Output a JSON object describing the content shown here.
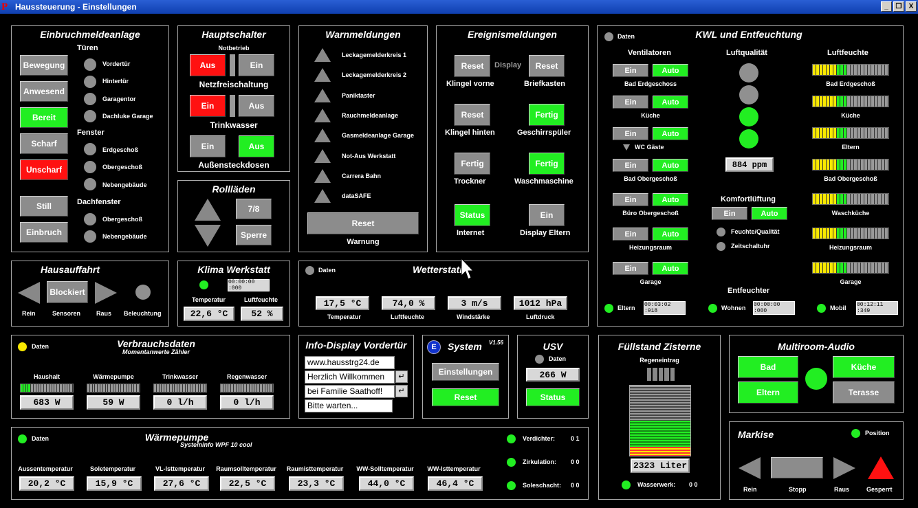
{
  "window": {
    "title": "Haussteuerung - Einstellungen",
    "logo": "P",
    "min": "_",
    "restore": "❐",
    "close": "X"
  },
  "einbruch": {
    "title": "Einbruchmeldeanlage",
    "tueren": "Türen",
    "fenster": "Fenster",
    "dachfenster": "Dachfenster",
    "btn_bewegung": "Bewegung",
    "btn_anwesend": "Anwesend",
    "btn_bereit": "Bereit",
    "btn_scharf": "Scharf",
    "btn_unscharf": "Unscharf",
    "btn_still": "Still",
    "btn_einbruch": "Einbruch",
    "t1": "Vordertür",
    "t2": "Hintertür",
    "t3": "Garagentor",
    "t4": "Dachluke Garage",
    "f1": "Erdgeschoß",
    "f2": "Obergeschoß",
    "f3": "Nebengebäude",
    "d1": "Obergeschoß",
    "d2": "Nebengebäude"
  },
  "haupt": {
    "title": "Hauptschalter",
    "notbetrieb": "Notbetrieb",
    "aus1": "Aus",
    "ein1": "Ein",
    "netzfrei": "Netzfreischaltung",
    "ein2": "Ein",
    "aus2": "Aus",
    "trinkwasser": "Trinkwasser",
    "ein3": "Ein",
    "aus3": "Aus",
    "aussen": "Außensteckdosen"
  },
  "warn": {
    "title": "Warnmeldungen",
    "items": [
      "Leckagemelderkreis 1",
      "Leckagemelderkreis 2",
      "Paniktaster",
      "Rauchmeldeanlage",
      "Gasmeldeanlage Garage",
      "Not-Aus Werkstatt",
      "Carrera Bahn",
      "dataSAFE"
    ],
    "reset": "Reset",
    "warnung": "Warnung"
  },
  "ereignis": {
    "title": "Ereignismeldungen",
    "reset1": "Reset",
    "display": "Display",
    "reset2": "Reset",
    "klingel_vorne": "Klingel vorne",
    "briefkasten": "Briefkasten",
    "reset3": "Reset",
    "fertig1": "Fertig",
    "klingel_hinten": "Klingel hinten",
    "geschirr": "Geschirrspüler",
    "fertig2": "Fertig",
    "fertig3": "Fertig",
    "trockner": "Trockner",
    "wasch": "Waschmaschine",
    "status": "Status",
    "ein": "Ein",
    "internet": "Internet",
    "display_eltern": "Display Eltern"
  },
  "kwl": {
    "title": "KWL und Entfeuchtung",
    "daten": "Daten",
    "ventilatoren": "Ventilatoren",
    "luftqualitaet": "Luftqualität",
    "luftfeuchte": "Luftfeuchte",
    "rooms": [
      "Bad Erdgeschoss",
      "Küche",
      "WC Gäste",
      "Bad Obergeschoß",
      "Büro Obergeschoß",
      "Heizungsraum",
      "Garage"
    ],
    "ein": "Ein",
    "auto": "Auto",
    "ppm": "884 ppm",
    "feuchte_rooms": [
      "Bad Erdgeschoß",
      "Küche",
      "Eltern",
      "Bad Obergeschoß",
      "Waschküche",
      "Heizungsraum",
      "Garage"
    ],
    "komfort": "Komfortlüftung",
    "k_ein": "Ein",
    "k_auto": "Auto",
    "feuchte_qual": "Feuchte/Qualität",
    "zeitschalt": "Zeitschaltuhr",
    "entfeuchter": "Entfeuchter",
    "eltern": "Eltern",
    "eltern_t": "00:03:02 :918",
    "wohnen": "Wohnen",
    "wohnen_t": "00:00:00 :000",
    "mobil": "Mobil",
    "mobil_t": "00:12:11 :349"
  },
  "rollladen": {
    "title": "Rollläden",
    "btn78": "7/8",
    "sperre": "Sperre"
  },
  "hausauffahrt": {
    "title": "Hausauffahrt",
    "blockiert": "Blockiert",
    "rein": "Rein",
    "sensoren": "Sensoren",
    "raus": "Raus",
    "beleuchtung": "Beleuchtung"
  },
  "klima": {
    "title": "Klima Werkstatt",
    "time": "00:00:00 :000",
    "temp_lbl": "Temperatur",
    "feuchte_lbl": "Luftfeuchte",
    "temp": "22,6 °C",
    "feuchte": "52 %"
  },
  "wetter": {
    "title": "Wetterstati",
    "daten": "Daten",
    "temp": "17,5 °C",
    "feuchte": "74,0 %",
    "wind": "3 m/s",
    "druck": "1012 hPa",
    "l1": "Temperatur",
    "l2": "Luftfeuchte",
    "l3": "Windstärke",
    "l4": "Luftdruck"
  },
  "verbrauch": {
    "title": "Verbrauchsdaten",
    "subtitle": "Momentanwerte Zähler",
    "daten": "Daten",
    "labels": [
      "Haushalt",
      "Wärmepumpe",
      "Trinkwasser",
      "Regenwasser"
    ],
    "values": [
      "683 W",
      "59 W",
      "0 l/h",
      "0 l/h"
    ]
  },
  "info": {
    "title": "Info-Display Vordertür",
    "lines": [
      "www.hausstrg24.de",
      "Herzlich Willkommen",
      "bei Familie Saathoff!",
      "Bitte warten..."
    ],
    "enter": "↵"
  },
  "system": {
    "title": "System",
    "version": "V1.56",
    "icon": "E",
    "einstellungen": "Einstellungen",
    "reset": "Reset"
  },
  "usv": {
    "title": "USV",
    "daten": "Daten",
    "value": "266 W",
    "status": "Status"
  },
  "zisterne": {
    "title": "Füllstand Zisterne",
    "regeneintrag": "Regeneintrag",
    "liter": "2323 Liter",
    "wasserwerk": "Wasserwerk:",
    "ww_val": "0 0",
    "fill_fraction": 0.5
  },
  "audio": {
    "title": "Multiroom-Audio",
    "bad": "Bad",
    "kueche": "Küche",
    "eltern": "Eltern",
    "terasse": "Terasse"
  },
  "markise": {
    "title": "Markise",
    "position": "Position",
    "rein": "Rein",
    "stopp": "Stopp",
    "raus": "Raus",
    "gesperrt": "Gesperrt"
  },
  "waerme": {
    "title": "Wärmepumpe",
    "subtitle": "Systeminfo WPF 10 cool",
    "daten": "Daten",
    "labels": [
      "Aussentemperatur",
      "Soletemperatur",
      "VL-Isttemperatur",
      "Raumsolltemperatur",
      "Raumisttemperatur",
      "WW-Solltemperatur",
      "WW-Isttemperatur"
    ],
    "values": [
      "20,2 °C",
      "15,9 °C",
      "27,6 °C",
      "22,5 °C",
      "23,3 °C",
      "44,0 °C",
      "46,4 °C"
    ],
    "verdichter": "Verdichter:",
    "verdichter_v": "0 1",
    "zirkulation": "Zirkulation:",
    "zirkulation_v": "0 0",
    "soleschacht": "Soleschacht:",
    "soleschacht_v": "0 0"
  },
  "colors": {
    "on": "#22ee22",
    "alarm": "#ff1111",
    "neutral": "#8c8c8c",
    "background": "#000000"
  }
}
